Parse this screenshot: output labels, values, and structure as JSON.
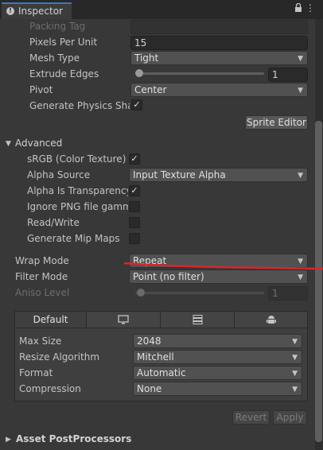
{
  "window": {
    "tab_label": "Inspector",
    "info_icon": "info-icon",
    "lock_icon": "lock-icon",
    "menu_icon": "kebab-menu-icon"
  },
  "sprite": {
    "packing_tag": {
      "label": "Packing Tag",
      "value": ""
    },
    "pixels_per_unit": {
      "label": "Pixels Per Unit",
      "value": "15"
    },
    "mesh_type": {
      "label": "Mesh Type",
      "value": "Tight"
    },
    "extrude_edges": {
      "label": "Extrude Edges",
      "value": "1",
      "slider_level": 0.06
    },
    "pivot": {
      "label": "Pivot",
      "value": "Center"
    },
    "generate_physics_shape": {
      "label": "Generate Physics Shap",
      "checked": true
    },
    "sprite_editor_button": "Sprite Editor"
  },
  "advanced": {
    "title": "Advanced",
    "srgb": {
      "label": "sRGB (Color Texture)",
      "checked": true
    },
    "alpha_source": {
      "label": "Alpha Source",
      "value": "Input Texture Alpha"
    },
    "alpha_is_transparency": {
      "label": "Alpha Is Transparency",
      "checked": true
    },
    "ignore_png_gamma": {
      "label": "Ignore PNG file gamma",
      "checked": false
    },
    "read_write": {
      "label": "Read/Write",
      "checked": false
    },
    "generate_mip_maps": {
      "label": "Generate Mip Maps",
      "checked": false
    }
  },
  "wrap_mode": {
    "label": "Wrap Mode",
    "value": "Repeat"
  },
  "filter_mode": {
    "label": "Filter Mode",
    "value": "Point (no filter)"
  },
  "aniso_level": {
    "label": "Aniso Level",
    "value": "1",
    "slider_level": 0.06
  },
  "platform": {
    "tabs": [
      {
        "label": "Default",
        "icon": ""
      },
      {
        "label": "",
        "icon": "monitor-icon"
      },
      {
        "label": "",
        "icon": "server-icon"
      },
      {
        "label": "",
        "icon": "android-icon"
      }
    ],
    "max_size": {
      "label": "Max Size",
      "value": "2048"
    },
    "resize_algorithm": {
      "label": "Resize Algorithm",
      "value": "Mitchell"
    },
    "format": {
      "label": "Format",
      "value": "Automatic"
    },
    "compression": {
      "label": "Compression",
      "value": "None"
    }
  },
  "buttons": {
    "revert": "Revert",
    "apply": "Apply"
  },
  "postprocessors": {
    "title": "Asset PostProcessors"
  },
  "colors": {
    "accent": "#3a79bb",
    "annotation": "#d9262b"
  }
}
